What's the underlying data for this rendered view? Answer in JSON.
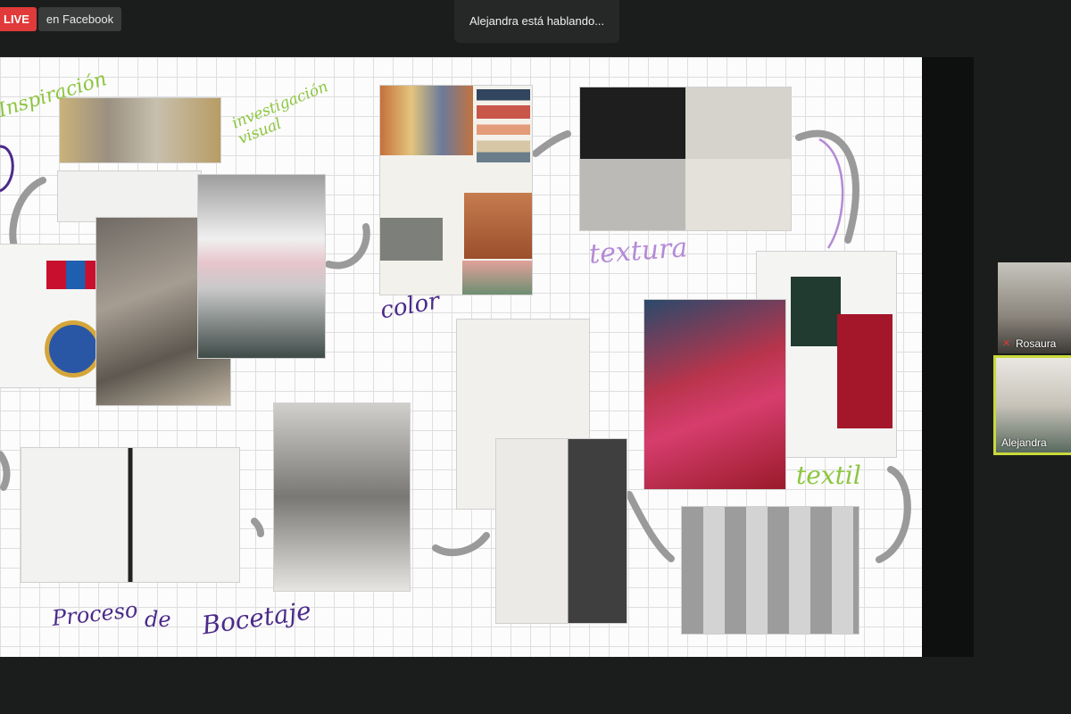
{
  "stream": {
    "live_label": "LIVE",
    "platform_label": "en Facebook"
  },
  "speaking": {
    "text": "Alejandra está hablando..."
  },
  "board": {
    "labels": {
      "inspiracion": "Inspiración",
      "investigacion": "investigación visual",
      "color": "color",
      "textura": "textura",
      "textil": "textil",
      "proceso": "Proceso",
      "de": "de",
      "bocetaje": "Bocetaje"
    }
  },
  "participants": [
    {
      "name": "Rosaura",
      "icon": "mic-muted-icon"
    },
    {
      "name": "Alejandra",
      "active": true
    }
  ],
  "colors": {
    "live": "#e03a3a",
    "active_border": "#c9d93a",
    "green_ink": "#8cc63f",
    "purple_ink": "#4b2a8a",
    "lilac_ink": "#b48ad6"
  }
}
